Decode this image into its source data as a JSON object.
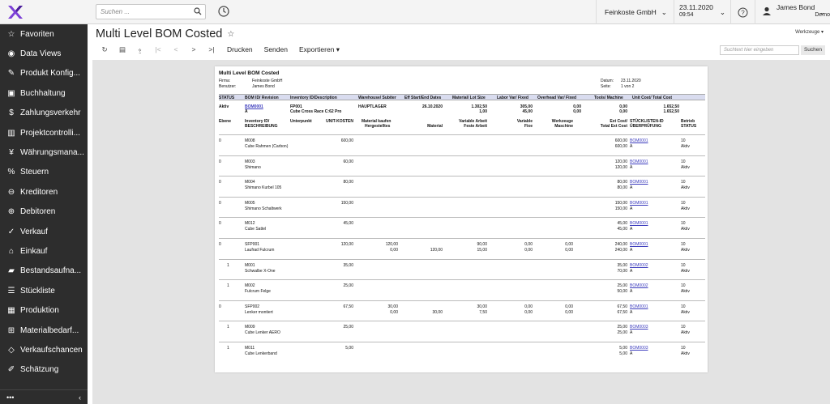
{
  "topbar": {
    "search_placeholder": "Suchen ...",
    "company": "Feinkoste GmbH",
    "date": "23.11.2020",
    "time": "09:54",
    "user_name": "James Bond",
    "user_role": "Demo"
  },
  "sidebar": {
    "items": [
      {
        "label": "Favoriten",
        "icon": "star-icon"
      },
      {
        "label": "Data Views",
        "icon": "globe-icon"
      },
      {
        "label": "Produkt Konfig...",
        "icon": "wrench-icon"
      },
      {
        "label": "Buchhaltung",
        "icon": "ledger-icon"
      },
      {
        "label": "Zahlungsverkehr",
        "icon": "dollar-icon"
      },
      {
        "label": "Projektcontrolli...",
        "icon": "chart-icon"
      },
      {
        "label": "Währungsmana...",
        "icon": "currency-icon"
      },
      {
        "label": "Steuern",
        "icon": "percent-icon"
      },
      {
        "label": "Kreditoren",
        "icon": "minus-circle-icon"
      },
      {
        "label": "Debitoren",
        "icon": "plus-circle-icon"
      },
      {
        "label": "Verkauf",
        "icon": "tag-icon"
      },
      {
        "label": "Einkauf",
        "icon": "cart-icon"
      },
      {
        "label": "Bestandsaufna...",
        "icon": "truck-icon"
      },
      {
        "label": "Stückliste",
        "icon": "list-icon"
      },
      {
        "label": "Produktion",
        "icon": "factory-icon"
      },
      {
        "label": "Materialbedarf...",
        "icon": "shopping-cart-icon"
      },
      {
        "label": "Verkaufschancen",
        "icon": "label-icon"
      },
      {
        "label": "Schätzung",
        "icon": "pencil-icon"
      }
    ],
    "footer_dots": "•••",
    "collapse": "‹"
  },
  "page": {
    "title": "Multi Level BOM Costed",
    "tools_label": "Werkzeuge"
  },
  "toolbar": {
    "print": "Drucken",
    "send": "Senden",
    "export": "Exportieren"
  },
  "report_search": {
    "placeholder": "Suchtext hier eingeben",
    "button": "Suchen"
  },
  "report": {
    "title": "Multi Level BOM Costed",
    "company_label": "Firma:",
    "company": "Feinkoste GmbH",
    "user_label": "Benutzer:",
    "user": "James Bond",
    "date_label": "Datum:",
    "date": "23.11.2020",
    "page_label": "Seite:",
    "page": "1 von 2",
    "col_headers": [
      "STATUS",
      "BOM ID/ Revision",
      "Inventory ID/Description",
      "Warehouse/ Subiter",
      "Eff Start/End Dates",
      "Material/ Lot Size",
      "Labor Var/ Fixed",
      "Overhead Var/ Fixed",
      "Tools/ Machine",
      "Unit Cost/ Total Cost"
    ],
    "main": {
      "status": "Aktiv",
      "bom": "BOM0001",
      "rev": "A",
      "inv": "FP001",
      "desc": "Cube Cross Race C:62 Pro",
      "wh": "HAUPTLAGER",
      "eff": "26.10.2020",
      "mat": "1.302,50",
      "lot": "1,00",
      "labor_v": "305,00",
      "labor_f": "45,00",
      "oh_v": "0,00",
      "oh_f": "0,00",
      "tools": "0,00",
      "machine": "0,00",
      "unit": "1.652,50",
      "total": "1.652,50"
    },
    "sub_headers": {
      "level": "Ebene",
      "inv": "Inventory ID/",
      "desc": "BESCHREIBUNG",
      "op": "Unterpunkt",
      "unit": "UNIT-KOSTEN",
      "mat_buy": "Material kaufen",
      "made": "Hergestelltes",
      "material": "Material",
      "var_labor": "Variable Arbeit",
      "fixed_labor": "Feste Arbeit",
      "var": "Variable",
      "fix": "Fixe",
      "tools": "Werkzeuge",
      "machine": "Maschine",
      "ext_cost": "Ext Cost/",
      "total_ext": "Total Ext Cost",
      "bom_id": "STÜCKLISTEN-ID",
      "rev": "ÜBERPRÜFUNG",
      "op2": "Betrieb",
      "status": "STATUS"
    },
    "rows": [
      {
        "level": "0",
        "inv": "M008",
        "desc": "Cube Rahmen (Carbon)",
        "unit": "600,00",
        "mb1": "",
        "mb2": "",
        "mat": "",
        "va": "",
        "fa": "",
        "v1": "",
        "v2": "",
        "t1": "",
        "t2": "",
        "ext": "600,00",
        "tot": "600,00",
        "bom": "BOM0001",
        "rev": "A",
        "op": "10",
        "st": "Aktiv"
      },
      {
        "level": "0",
        "inv": "M003",
        "desc": "Shimano",
        "unit": "60,00",
        "mb1": "",
        "mb2": "",
        "mat": "",
        "va": "",
        "fa": "",
        "v1": "",
        "v2": "",
        "t1": "",
        "t2": "",
        "ext": "120,00",
        "tot": "120,00",
        "bom": "BOM0001",
        "rev": "A",
        "op": "10",
        "st": "Aktiv"
      },
      {
        "level": "0",
        "inv": "M004",
        "desc": "Shimano Kurbel 105",
        "unit": "80,00",
        "mb1": "",
        "mb2": "",
        "mat": "",
        "va": "",
        "fa": "",
        "v1": "",
        "v2": "",
        "t1": "",
        "t2": "",
        "ext": "80,00",
        "tot": "80,00",
        "bom": "BOM0001",
        "rev": "A",
        "op": "10",
        "st": "Aktiv"
      },
      {
        "level": "0",
        "inv": "M005",
        "desc": "Shimano Schaltwerk",
        "unit": "150,00",
        "mb1": "",
        "mb2": "",
        "mat": "",
        "va": "",
        "fa": "",
        "v1": "",
        "v2": "",
        "t1": "",
        "t2": "",
        "ext": "150,00",
        "tot": "150,00",
        "bom": "BOM0001",
        "rev": "A",
        "op": "10",
        "st": "Aktiv"
      },
      {
        "level": "0",
        "inv": "M012",
        "desc": "Cube Sattel",
        "unit": "45,00",
        "mb1": "",
        "mb2": "",
        "mat": "",
        "va": "",
        "fa": "",
        "v1": "",
        "v2": "",
        "t1": "",
        "t2": "",
        "ext": "45,00",
        "tot": "45,00",
        "bom": "BOM0001",
        "rev": "A",
        "op": "10",
        "st": "Aktiv"
      },
      {
        "level": "0",
        "inv": "SFP001",
        "desc": "Laufrad Fulcrum",
        "unit": "120,00",
        "mb1": "120,00",
        "mb2": "0,00",
        "mat": "120,00",
        "va": "90,00",
        "fa": "15,00",
        "v1": "0,00",
        "v2": "0,00",
        "t1": "0,00",
        "t2": "0,00",
        "ext": "240,00",
        "tot": "240,00",
        "bom": "BOM0001",
        "rev": "A",
        "op": "10",
        "st": "Aktiv"
      },
      {
        "level": "1",
        "inv": "M001",
        "desc": "Schwalbe X-One",
        "unit": "35,00",
        "mb1": "",
        "mb2": "",
        "mat": "",
        "va": "",
        "fa": "",
        "v1": "",
        "v2": "",
        "t1": "",
        "t2": "",
        "ext": "35,00",
        "tot": "70,00",
        "bom": "BOM0002",
        "rev": "A",
        "op": "10",
        "st": "Aktiv"
      },
      {
        "level": "1",
        "inv": "M002",
        "desc": "Fulcrum Felge",
        "unit": "25,00",
        "mb1": "",
        "mb2": "",
        "mat": "",
        "va": "",
        "fa": "",
        "v1": "",
        "v2": "",
        "t1": "",
        "t2": "",
        "ext": "25,00",
        "tot": "50,00",
        "bom": "BOM0002",
        "rev": "A",
        "op": "10",
        "st": "Aktiv"
      },
      {
        "level": "0",
        "inv": "SFP002",
        "desc": "Lenker montiert",
        "unit": "67,50",
        "mb1": "30,00",
        "mb2": "0,00",
        "mat": "30,00",
        "va": "30,00",
        "fa": "7,50",
        "v1": "0,00",
        "v2": "0,00",
        "t1": "0,00",
        "t2": "0,00",
        "ext": "67,50",
        "tot": "67,50",
        "bom": "BOM0001",
        "rev": "A",
        "op": "10",
        "st": "Aktiv"
      },
      {
        "level": "1",
        "inv": "M009",
        "desc": "Cube Lenker AERO",
        "unit": "25,00",
        "mb1": "",
        "mb2": "",
        "mat": "",
        "va": "",
        "fa": "",
        "v1": "",
        "v2": "",
        "t1": "",
        "t2": "",
        "ext": "25,00",
        "tot": "25,00",
        "bom": "BOM0003",
        "rev": "A",
        "op": "10",
        "st": "Aktiv"
      },
      {
        "level": "1",
        "inv": "M011",
        "desc": "Cube Lenkerband",
        "unit": "5,00",
        "mb1": "",
        "mb2": "",
        "mat": "",
        "va": "",
        "fa": "",
        "v1": "",
        "v2": "",
        "t1": "",
        "t2": "",
        "ext": "5,00",
        "tot": "5,00",
        "bom": "BOM0003",
        "rev": "A",
        "op": "10",
        "st": "Aktiv"
      }
    ]
  }
}
